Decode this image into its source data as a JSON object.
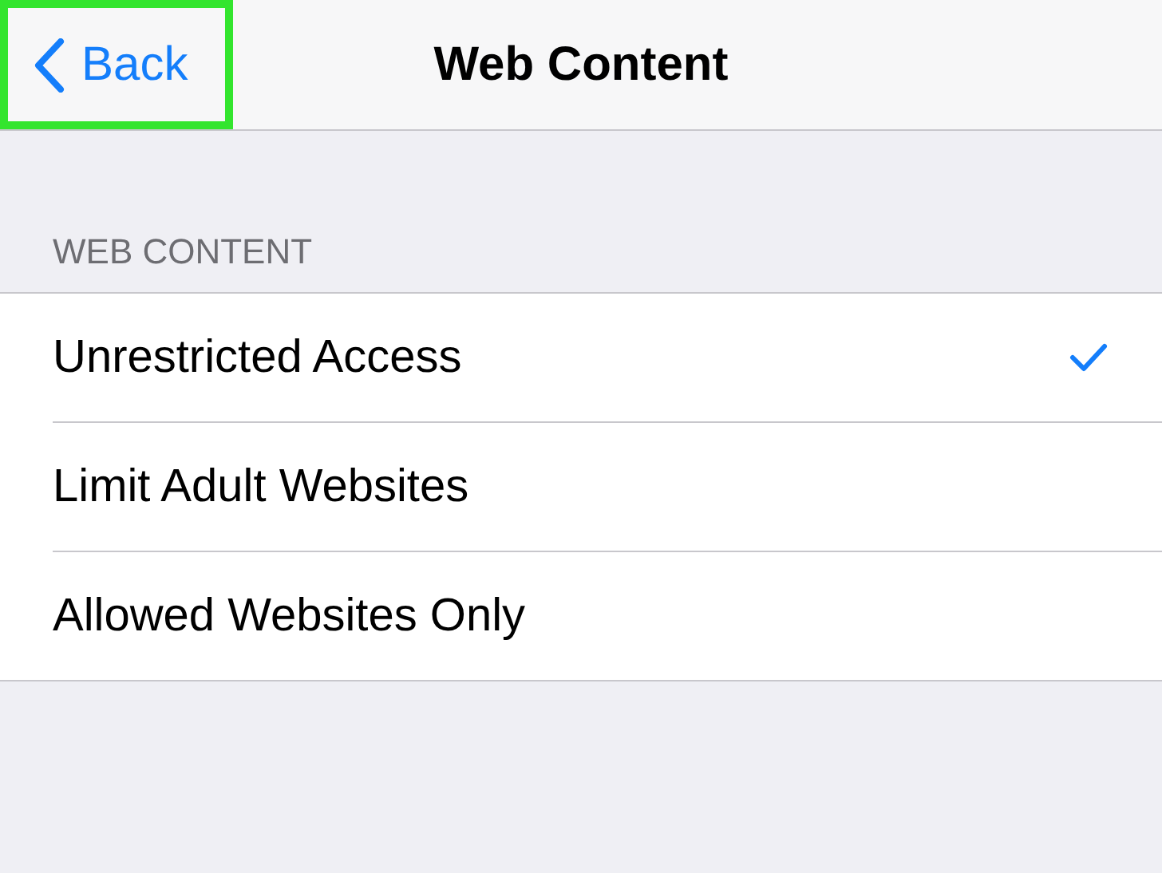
{
  "nav_bar": {
    "back_button": {
      "label": "Back",
      "highlighted": true
    },
    "title": "Web Content"
  },
  "section": {
    "header": "WEB CONTENT",
    "options": [
      {
        "label": "Unrestricted Access",
        "selected": true
      },
      {
        "label": "Limit Adult Websites",
        "selected": false
      },
      {
        "label": "Allowed Websites Only",
        "selected": false
      }
    ]
  }
}
